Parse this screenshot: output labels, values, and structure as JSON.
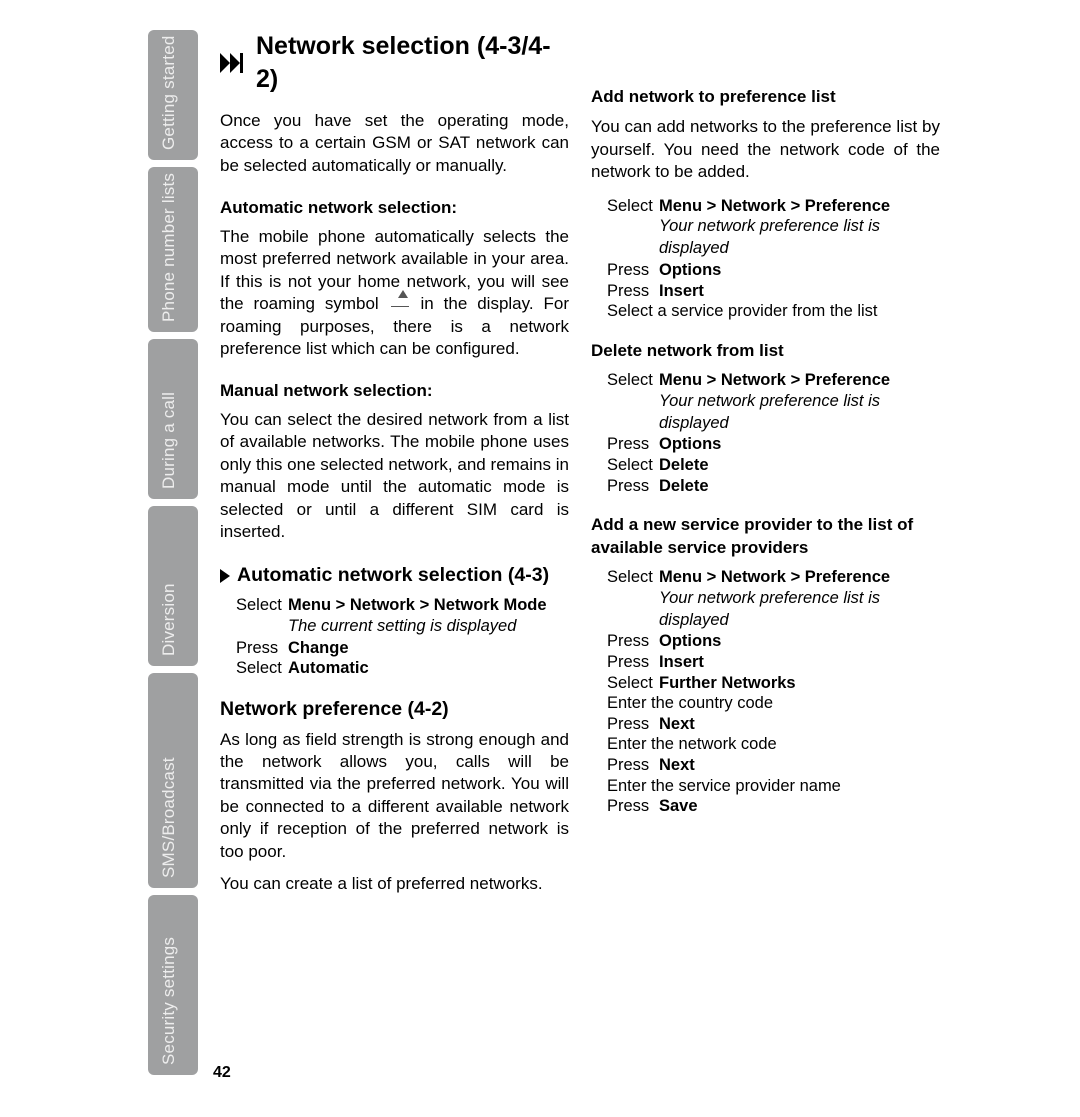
{
  "sidebar": {
    "tabs": [
      "Getting started",
      "Phone number lists",
      "During a call",
      "Diversion",
      "SMS/Broadcast",
      "Security settings"
    ]
  },
  "main": {
    "title": "Network selection (4-3/4-2)",
    "intro": "Once you have set the operating mode, access to a certain GSM or SAT network can be selected automatically or manually.",
    "auto_heading": "Automatic network selection:",
    "auto_body_part1": "The mobile phone automatically selects the most preferred network available in your area. If this is not your home network, you will see the roaming symbol ",
    "auto_body_part2": " in the display. For roaming purposes, there is a network preference list which can be configured.",
    "manual_heading": "Manual network selection:",
    "manual_body": "You can select the desired network from a list of available networks. The mobile phone uses only this one selected network, and remains in manual mode until the automatic mode is selected or until a different SIM card is inserted.",
    "auto43_heading": "Automatic network selection (4-3)",
    "auto43_steps": [
      {
        "action": "Select",
        "value": "Menu > Network > Network Mode",
        "bold": true
      },
      {
        "italic": "The current setting is displayed"
      },
      {
        "action": "Press",
        "value": "Change",
        "bold": true
      },
      {
        "action": "Select",
        "value": "Automatic",
        "bold": true
      }
    ],
    "pref_heading": "Network preference (4-2)",
    "pref_body1": "As long as field strength is strong enough and the network allows you, calls will be transmitted via the preferred network. You will be connected to a different available network only if reception of the preferred network is too poor.",
    "pref_body2": "You can create a list of preferred networks."
  },
  "col2": {
    "add_heading": "Add network to preference list",
    "add_body": "You can add networks to the preference list by yourself. You need the network code of the network to be added.",
    "add_steps": [
      {
        "action": "Select",
        "value": "Menu > Network > Preference",
        "bold": true
      },
      {
        "italic": "Your network preference list is displayed"
      },
      {
        "action": "Press",
        "value": "Options",
        "bold": true
      },
      {
        "action": "Press",
        "value": "Insert",
        "bold": true
      },
      {
        "plain": "Select a service provider from the list"
      }
    ],
    "delete_heading": "Delete network from list",
    "delete_steps": [
      {
        "action": "Select",
        "value": "Menu > Network > Preference",
        "bold": true
      },
      {
        "italic": "Your network preference list is displayed"
      },
      {
        "action": "Press",
        "value": "Options",
        "bold": true
      },
      {
        "action": "Select",
        "value": "Delete",
        "bold": true
      },
      {
        "action": "Press",
        "value": "Delete",
        "bold": true
      }
    ],
    "addprov_heading": "Add a new service provider to the list of available service providers",
    "addprov_steps": [
      {
        "action": "Select",
        "value": "Menu > Network > Preference",
        "bold": true
      },
      {
        "italic": "Your network preference list is displayed"
      },
      {
        "action": "Press",
        "value": "Options",
        "bold": true
      },
      {
        "action": "Press",
        "value": "Insert",
        "bold": true
      },
      {
        "action": "Select",
        "value": "Further Networks",
        "bold": true
      },
      {
        "plain": "Enter the country code"
      },
      {
        "action": "Press",
        "value": "Next",
        "bold": true
      },
      {
        "plain": "Enter the network code"
      },
      {
        "action": "Press",
        "value": "Next",
        "bold": true
      },
      {
        "plain": "Enter the service provider name"
      },
      {
        "action": "Press",
        "value": "Save",
        "bold": true
      }
    ]
  },
  "page_number": "42"
}
